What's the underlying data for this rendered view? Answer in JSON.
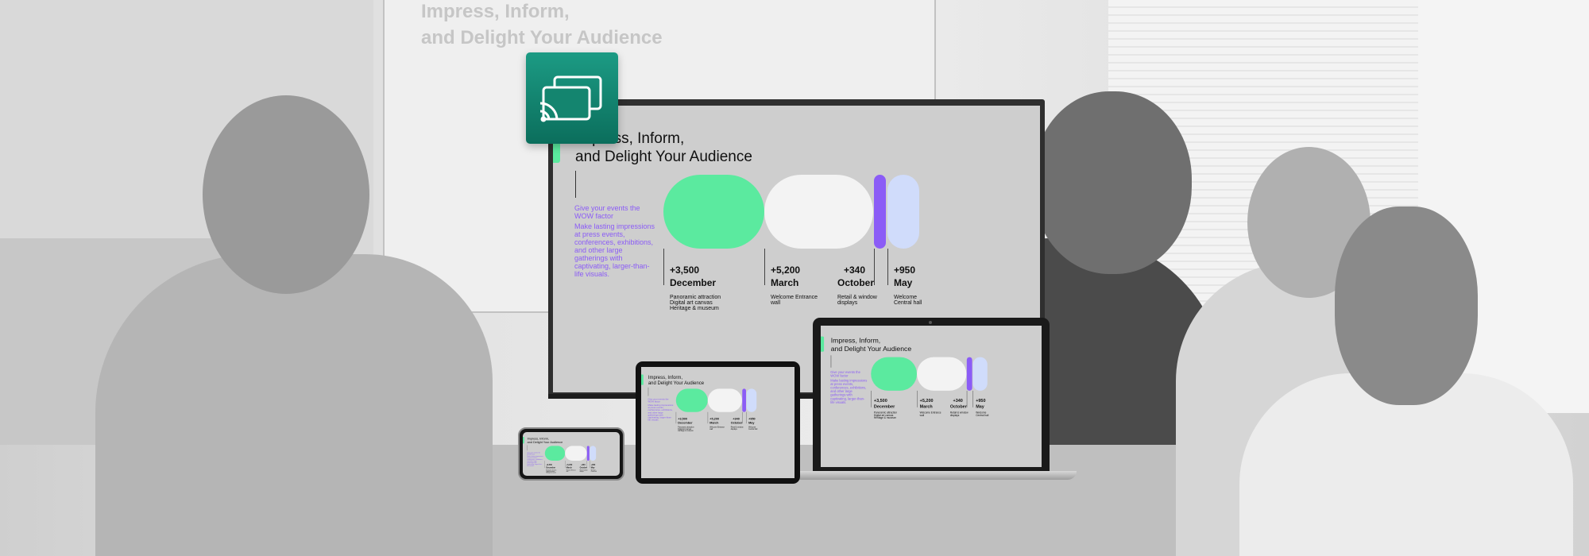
{
  "slide": {
    "title_line1": "Impress, Inform,",
    "title_line2": "and Delight Your Audience",
    "tagline": "Give your events the WOW factor",
    "description": "Make lasting impressions at press events, conferences, exhibitions, and other large gatherings with captivating, larger-than-life visuals.",
    "stats": [
      {
        "value": "+3,500",
        "month": "December",
        "note": "Panoramic attraction Digital art canvas Heritage & museum"
      },
      {
        "value": "+5,200",
        "month": "March",
        "note": "Welcome Entrance wall"
      },
      {
        "value": "+340",
        "month": "October",
        "note": "Retail & window displays"
      },
      {
        "value": "+950",
        "month": "May",
        "note": "Welcome Central hall"
      }
    ]
  },
  "background_board": {
    "title_line1": "Impress, Inform,",
    "title_line2": "and Delight Your Audience"
  },
  "app_icon": {
    "name": "screen-cast-icon"
  },
  "colors": {
    "accent_green": "#5bea9f",
    "accent_purple": "#8b5cf6",
    "light_blue": "#d0dcfb",
    "icon_teal": "#14856f"
  }
}
